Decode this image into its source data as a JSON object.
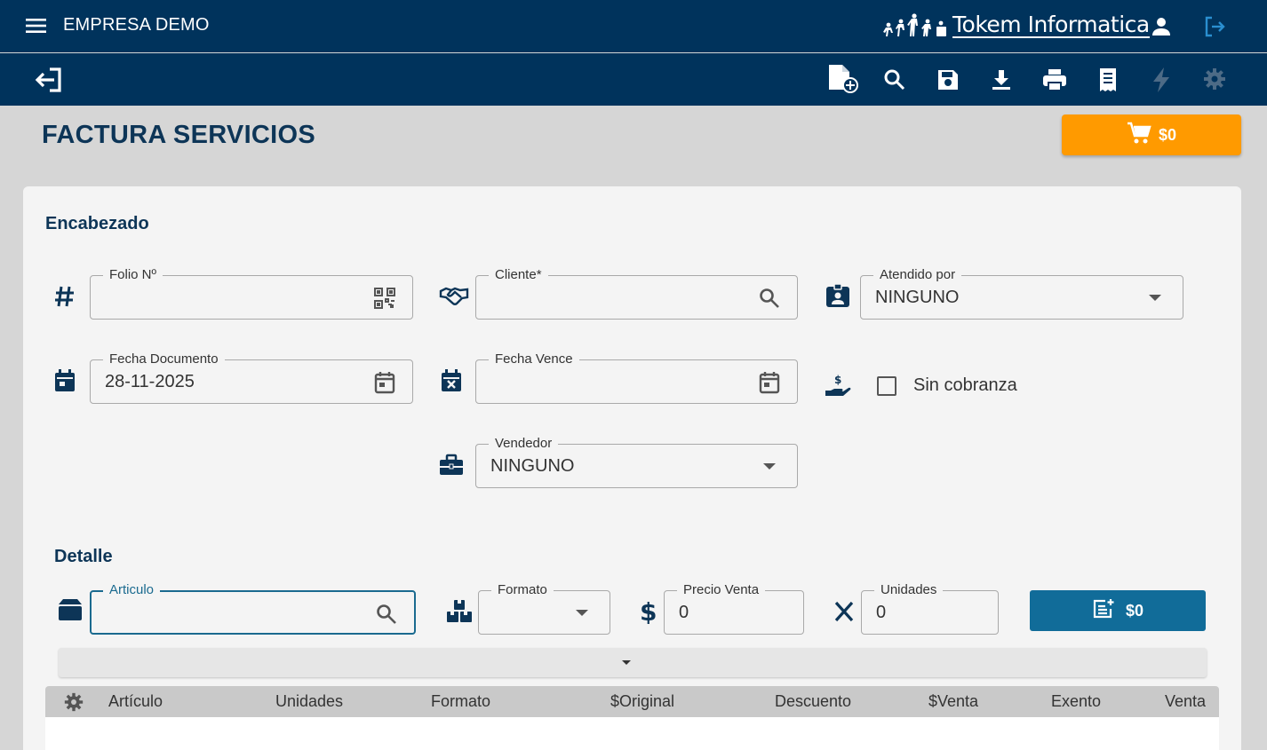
{
  "header": {
    "company": "EMPRESA DEMO",
    "brand": "Tokem Informatica"
  },
  "page": {
    "title": "FACTURA SERVICIOS",
    "cart_total": "$0"
  },
  "encabezado": {
    "title": "Encabezado",
    "folio": {
      "label": "Folio Nº",
      "value": ""
    },
    "cliente": {
      "label": "Cliente*",
      "value": ""
    },
    "atendido": {
      "label": "Atendido por",
      "value": "NINGUNO"
    },
    "fecha_documento": {
      "label": "Fecha Documento",
      "value": "28-11-2025"
    },
    "fecha_vence": {
      "label": "Fecha Vence",
      "value": ""
    },
    "sin_cobranza": {
      "label": "Sin cobranza",
      "checked": false
    },
    "vendedor": {
      "label": "Vendedor",
      "value": "NINGUNO"
    }
  },
  "detalle": {
    "title": "Detalle",
    "articulo": {
      "label": "Articulo",
      "value": ""
    },
    "formato": {
      "label": "Formato",
      "value": ""
    },
    "precio_venta": {
      "label": "Precio Venta",
      "value": "0"
    },
    "unidades": {
      "label": "Unidades",
      "value": "0"
    },
    "add_total": "$0"
  },
  "table": {
    "columns": [
      "Artículo",
      "Unidades",
      "Formato",
      "$Original",
      "Descuento",
      "$Venta",
      "Exento",
      "Venta"
    ],
    "rows": []
  },
  "colors": {
    "navbar": "#00335c",
    "accent_orange": "#ff9a00",
    "primary_blue": "#116c99",
    "title": "#0d3557"
  }
}
